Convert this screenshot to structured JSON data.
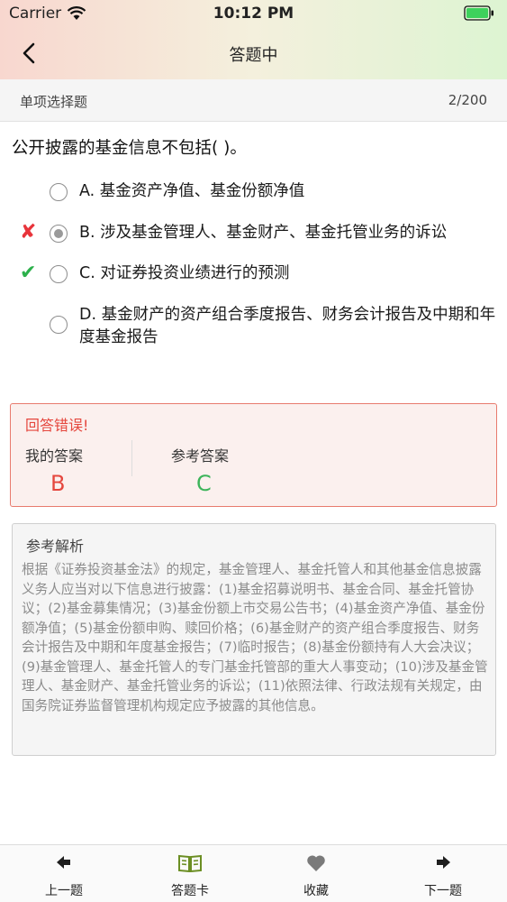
{
  "status_bar": {
    "carrier": "Carrier",
    "time": "10:12 PM"
  },
  "nav": {
    "title": "答题中"
  },
  "section": {
    "type_label": "单项选择题",
    "progress": "2/200"
  },
  "question": {
    "text": "公开披露的基金信息不包括(    )。"
  },
  "options": [
    {
      "label": "A. 基金资产净值、基金份额净值",
      "selected": false,
      "mark": ""
    },
    {
      "label": "B. 涉及基金管理人、基金财产、基金托管业务的诉讼",
      "selected": true,
      "mark": "✘"
    },
    {
      "label": "C. 对证券投资业绩进行的预测",
      "selected": false,
      "mark": "✔"
    },
    {
      "label": "D. 基金财产的资产组合季度报告、财务会计报告及中期和年度基金报告",
      "selected": false,
      "mark": ""
    }
  ],
  "result": {
    "title": "回答错误!",
    "my_answer_label": "我的答案",
    "my_answer": "B",
    "ref_answer_label": "参考答案",
    "ref_answer": "C"
  },
  "analysis": {
    "title": "参考解析",
    "text": "根据《证券投资基金法》的规定，基金管理人、基金托管人和其他基金信息披露义务人应当对以下信息进行披露：(1)基金招募说明书、基金合同、基金托管协议；(2)基金募集情况；(3)基金份额上市交易公告书；(4)基金资产净值、基金份额净值；(5)基金份额申购、赎回价格；(6)基金财产的资产组合季度报告、财务会计报告及中期和年度基金报告；(7)临时报告；(8)基金份额持有人大会决议；(9)基金管理人、基金托管人的专门基金托管部的重大人事变动；(10)涉及基金管理人、基金财产、基金托管业务的诉讼；(11)依照法律、行政法规有关规定，由国务院证券监督管理机构规定应予披露的其他信息。"
  },
  "tabs": [
    {
      "label": "上一题",
      "icon": "arrow-left-icon"
    },
    {
      "label": "答题卡",
      "icon": "answer-card-icon"
    },
    {
      "label": "收藏",
      "icon": "heart-icon"
    },
    {
      "label": "下一题",
      "icon": "arrow-right-icon"
    }
  ],
  "colors": {
    "wrong": "#e5473e",
    "correct": "#3cb45a",
    "accent_green": "#6b8e23"
  }
}
